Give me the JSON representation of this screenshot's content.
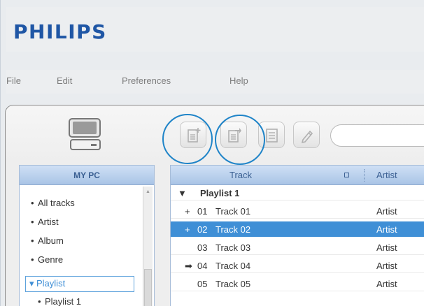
{
  "brand": {
    "logo_text": "PHILIPS",
    "color": "#1f56a5"
  },
  "menu": [
    "File",
    "Edit",
    "Preferences",
    "Help"
  ],
  "toolbar": {
    "buttons": [
      {
        "icon": "new-playlist-icon"
      },
      {
        "icon": "add-to-playlist-icon"
      },
      {
        "icon": "properties-icon"
      },
      {
        "icon": "edit-icon"
      }
    ],
    "search": {
      "value": "",
      "placeholder": ""
    }
  },
  "sidebar": {
    "title": "MY PC",
    "items": [
      {
        "label": "All tracks",
        "bullet": "•"
      },
      {
        "label": "Artist",
        "bullet": "•"
      },
      {
        "label": "Album",
        "bullet": "•"
      },
      {
        "label": "Genre",
        "bullet": "•"
      },
      {
        "label": "Playlist",
        "bullet": "▾",
        "selected": true
      },
      {
        "label": "Playlist 1",
        "bullet": "•",
        "child": true
      }
    ]
  },
  "tracklist": {
    "columns": {
      "track": "Track",
      "artist": "Artist"
    },
    "group": {
      "toggle": "▼",
      "label": "Playlist 1"
    },
    "rows": [
      {
        "arrow": "+",
        "num": "01",
        "title": "Track 01",
        "artist": "Artist",
        "selected": false
      },
      {
        "arrow": "+",
        "num": "02",
        "title": "Track 02",
        "artist": "Artist",
        "selected": true
      },
      {
        "arrow": "",
        "num": "03",
        "title": "Track 03",
        "artist": "Artist",
        "selected": false
      },
      {
        "arrow": "➡",
        "num": "04",
        "title": "Track 04",
        "artist": "Artist",
        "selected": false
      },
      {
        "arrow": "",
        "num": "05",
        "title": "Track 05",
        "artist": "Artist",
        "selected": false
      }
    ]
  },
  "colors": {
    "accent": "#3f8fd6",
    "annotation": "#1f84c8",
    "header": "#a9c4e6"
  }
}
